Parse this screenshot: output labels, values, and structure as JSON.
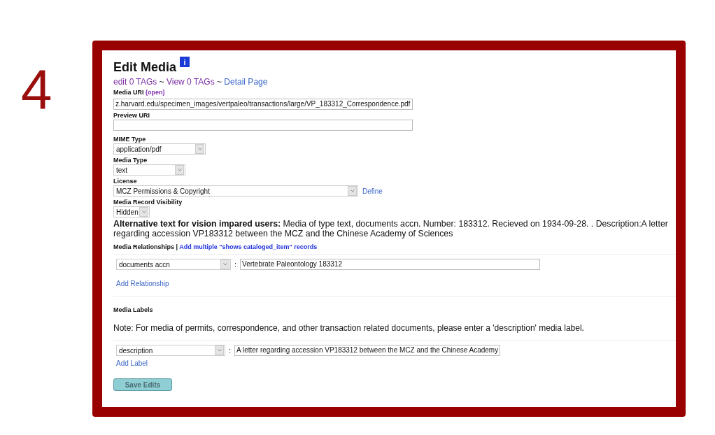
{
  "slide_number": "4",
  "page": {
    "title": "Edit Media",
    "info_badge": "i",
    "nav": [
      {
        "kind": "link",
        "text": "edit 0 TAGs",
        "visited": true
      },
      {
        "kind": "separator",
        "text": "~"
      },
      {
        "kind": "link",
        "text": "View 0 TAGs",
        "visited": true
      },
      {
        "kind": "separator",
        "text": "~"
      },
      {
        "kind": "link",
        "text": "Detail Page",
        "visited": false
      }
    ],
    "fields": [
      {
        "kind": "text",
        "label": "Media URI",
        "label_link": "(open)",
        "value": "z.harvard.edu/specimen_images/vertpaleo/transactions/large/VP_183312_Correspondence.pdf"
      },
      {
        "kind": "text",
        "label": "Preview URI"
      },
      {
        "kind": "select",
        "label": "MIME Type",
        "value": "application/pdf"
      },
      {
        "kind": "select",
        "label": "Media Type",
        "value": "text"
      },
      {
        "kind": "select",
        "label": "License",
        "value": "MCZ Permissions & Copyright",
        "link": "Define"
      },
      {
        "kind": "select",
        "label": "Media Record Visibility",
        "value": "Hidden"
      }
    ],
    "alt_text": "**Alternative text for vision impared users:** Media of type text, documents accn. Number: 183312. Recieved on 1934-09-28. . Description:A letter regarding accession VP183312 between the MCZ and the Chinese Academy of Sciences",
    "relationships": {
      "heading": "Media Relationships",
      "separator": "|",
      "link": "Add multiple \"shows cataloged_item\" records",
      "rows": [
        {
          "type": "documents accn",
          "colon": ":",
          "value": "Vertebrate Paleontology 183312"
        }
      ],
      "add_link": "Add Relationship"
    },
    "labels": {
      "heading": "Media Labels",
      "note": "Note: For media of permits, correspondence, and other transaction related documents, please enter a 'description' media label.",
      "rows": [
        {
          "type": "description",
          "colon": ":",
          "value": "A letter regarding accession VP183312 between the MCZ and the Chinese Academy"
        }
      ],
      "add_link": "Add Label"
    },
    "save_button": "Save Edits"
  }
}
